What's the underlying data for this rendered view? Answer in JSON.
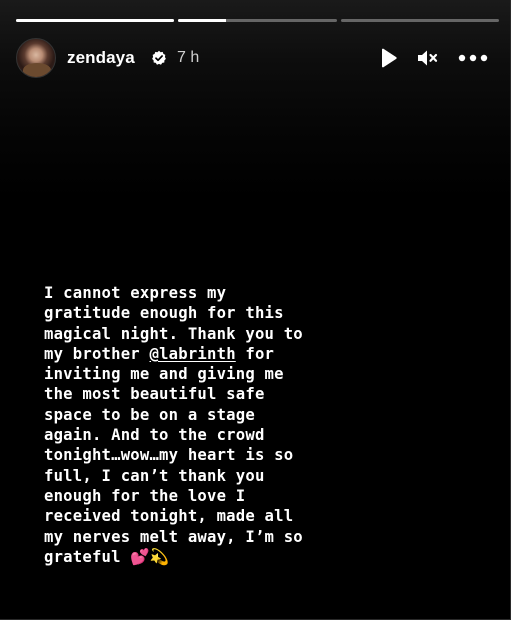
{
  "story": {
    "progress": [
      1.0,
      0.3,
      0.0
    ],
    "user": {
      "username": "zendaya",
      "verified": true,
      "time_ago": "7 h"
    },
    "controls": {
      "play_icon": "play-icon",
      "mute_icon": "volume-muted-icon",
      "more_icon": "more-horizontal-icon"
    },
    "caption": {
      "lines": [
        "I cannot express my",
        "gratitude enough for this",
        "magical night. Thank you to",
        "my brother ",
        "inviting me and giving me",
        "the most beautiful safe",
        "space to be on a stage",
        "again. And to the crowd",
        "tonight…wow…my heart is so",
        "full, I can’t thank you",
        "enough for the love I",
        "received tonight, made all",
        "my nerves melt away, I’m so",
        "grateful "
      ],
      "mention": "@labrinth",
      "after_mention": " for",
      "emoji_1": "💕",
      "emoji_2": "💫"
    }
  }
}
